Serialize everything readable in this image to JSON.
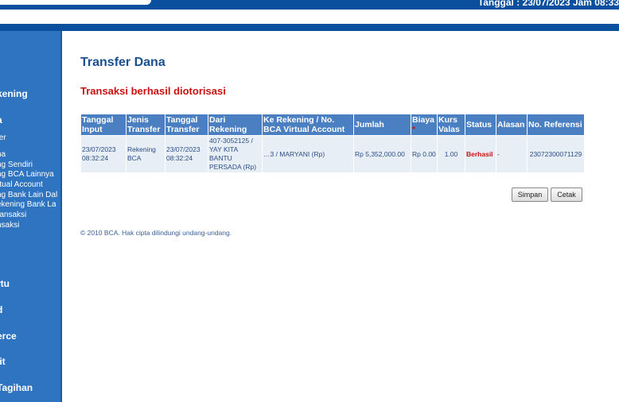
{
  "header": {
    "date_text": "Tanggal : 23/07/2023 Jam 08:33"
  },
  "sidebar": {
    "items": [
      {
        "label": "kening",
        "type": "head"
      },
      {
        "label": "a",
        "type": "head"
      },
      {
        "label": "fer",
        "type": "item"
      },
      {
        "label": "na",
        "type": "item"
      },
      {
        "label": "ng Sendiri",
        "type": "item"
      },
      {
        "label": "ng BCA Lainnya",
        "type": "item"
      },
      {
        "label": "rtual Account",
        "type": "item"
      },
      {
        "label": "ng Bank Lain Dal",
        "type": "item"
      },
      {
        "label": "ekening Bank La",
        "type": "item"
      },
      {
        "label": "ransaksi",
        "type": "item"
      },
      {
        "label": "nsaksi",
        "type": "item"
      },
      {
        "label": "rtu",
        "type": "head"
      },
      {
        "label": "d",
        "type": "head"
      },
      {
        "label": "erce",
        "type": "head"
      },
      {
        "label": "lit",
        "type": "head"
      },
      {
        "label": "Tagihan",
        "type": "head"
      }
    ]
  },
  "main": {
    "title": "Transfer Dana",
    "status_message": "Transaksi berhasil diotorisasi",
    "table": {
      "headers": {
        "tanggal_input": "Tanggal Input",
        "jenis_transfer": "Jenis Transfer",
        "tanggal_transfer": "Tanggal Transfer",
        "dari_rekening": "Dari Rekening",
        "ke_rekening": "Ke Rekening / No. BCA Virtual Account",
        "jumlah": "Jumlah",
        "biaya": "Biaya",
        "biaya_mark": "*",
        "kurs_valas": "Kurs Valas",
        "status": "Status",
        "alasan": "Alasan",
        "no_referensi": "No. Referensi"
      },
      "row": {
        "tanggal_input": "23/07/2023 08:32:24",
        "jenis_transfer": "Rekening BCA",
        "tanggal_transfer": "23/07/2023 08:32:24",
        "dari_rekening": "407-3052125 / YAY KITA BANTU PERSADA (Rp)",
        "ke_rekening": "…3 / MARYANI (Rp)",
        "jumlah": "Rp 5,352,000.00",
        "biaya": "Rp 0.00",
        "kurs_valas": "1.00",
        "status": "Berhasil",
        "alasan": "-",
        "no_referensi": "23072300071129"
      }
    },
    "buttons": {
      "simpan": "Simpan",
      "cetak": "Cetak"
    },
    "footer": "©  2010 BCA. Hak cipta dilindungi undang-undang."
  }
}
